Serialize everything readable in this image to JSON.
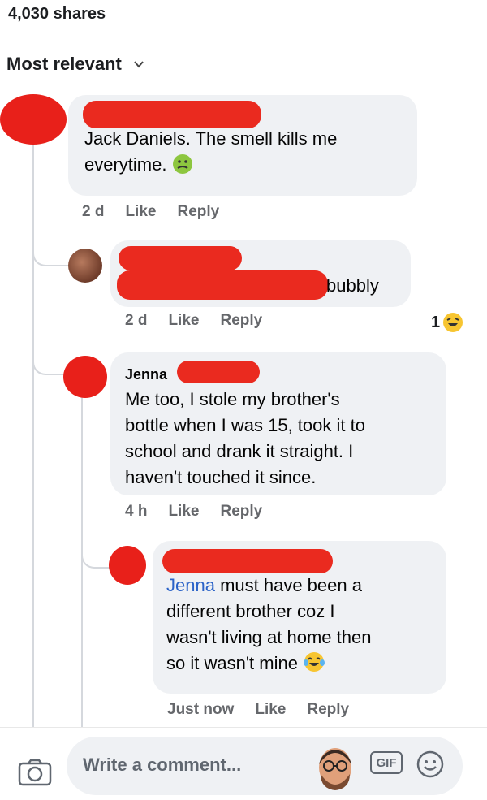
{
  "header": {
    "shares": "4,030 shares",
    "sort_label": "Most relevant"
  },
  "comments": [
    {
      "name": "",
      "text_line1": "Jack Daniels. The smell kills me",
      "text_line2": "everytime.",
      "emoji": "nauseated-face-emoji",
      "time": "2 d",
      "like": "Like",
      "reply": "Reply"
    },
    {
      "name": "",
      "text": "bubbly",
      "time": "2 d",
      "like": "Like",
      "reply": "Reply",
      "reaction_count": "1",
      "reaction_emoji": "laughing-face-emoji"
    },
    {
      "name": "Jenna",
      "text_lines": [
        "Me too, I stole my brother's",
        "bottle when I was 15, took it to",
        "school and drank it straight. I",
        "haven't touched it since."
      ],
      "time": "4 h",
      "like": "Like",
      "reply": "Reply"
    },
    {
      "name": "",
      "mention": "Jenna",
      "line1_rest": " must have been a",
      "text_lines": [
        "different brother coz I",
        "wasn't living at home then",
        "so it wasn't mine"
      ],
      "emoji": "tears-of-joy-emoji",
      "time": "Just now",
      "like": "Like",
      "reply": "Reply"
    }
  ],
  "composer": {
    "placeholder": "Write a comment...",
    "gif_label": "GIF"
  }
}
